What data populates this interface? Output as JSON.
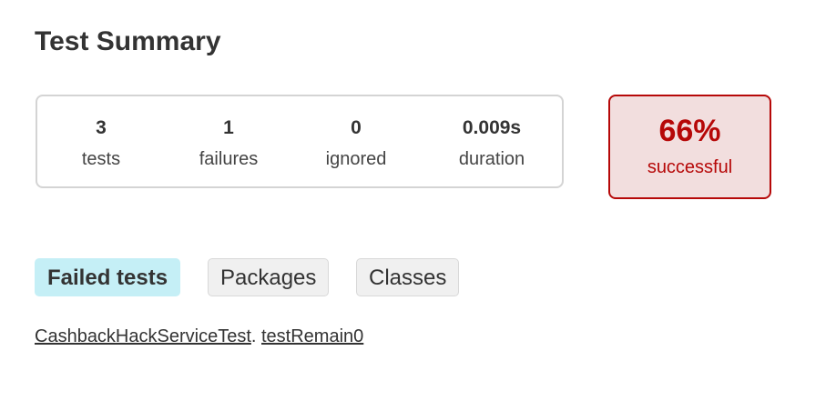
{
  "page": {
    "title": "Test Summary"
  },
  "summary": {
    "counters": [
      {
        "value": "3",
        "label": "tests"
      },
      {
        "value": "1",
        "label": "failures"
      },
      {
        "value": "0",
        "label": "ignored"
      },
      {
        "value": "0.009s",
        "label": "duration"
      }
    ],
    "success_rate": "66%",
    "success_label": "successful"
  },
  "tabs": [
    {
      "label": "Failed tests",
      "selected": true
    },
    {
      "label": "Packages",
      "selected": false
    },
    {
      "label": "Classes",
      "selected": false
    }
  ],
  "failed_tests": [
    {
      "class_name": "CashbackHackServiceTest",
      "separator": ".",
      "test_name": "testRemain0"
    }
  ],
  "colors": {
    "failure_text": "#b60808",
    "failure_border": "#b60808",
    "failure_background": "#f2dede",
    "selected_tab_background": "#c5eff6",
    "tab_background": "#f0f0f0",
    "box_border": "#d4d4d4",
    "text": "#333333"
  }
}
